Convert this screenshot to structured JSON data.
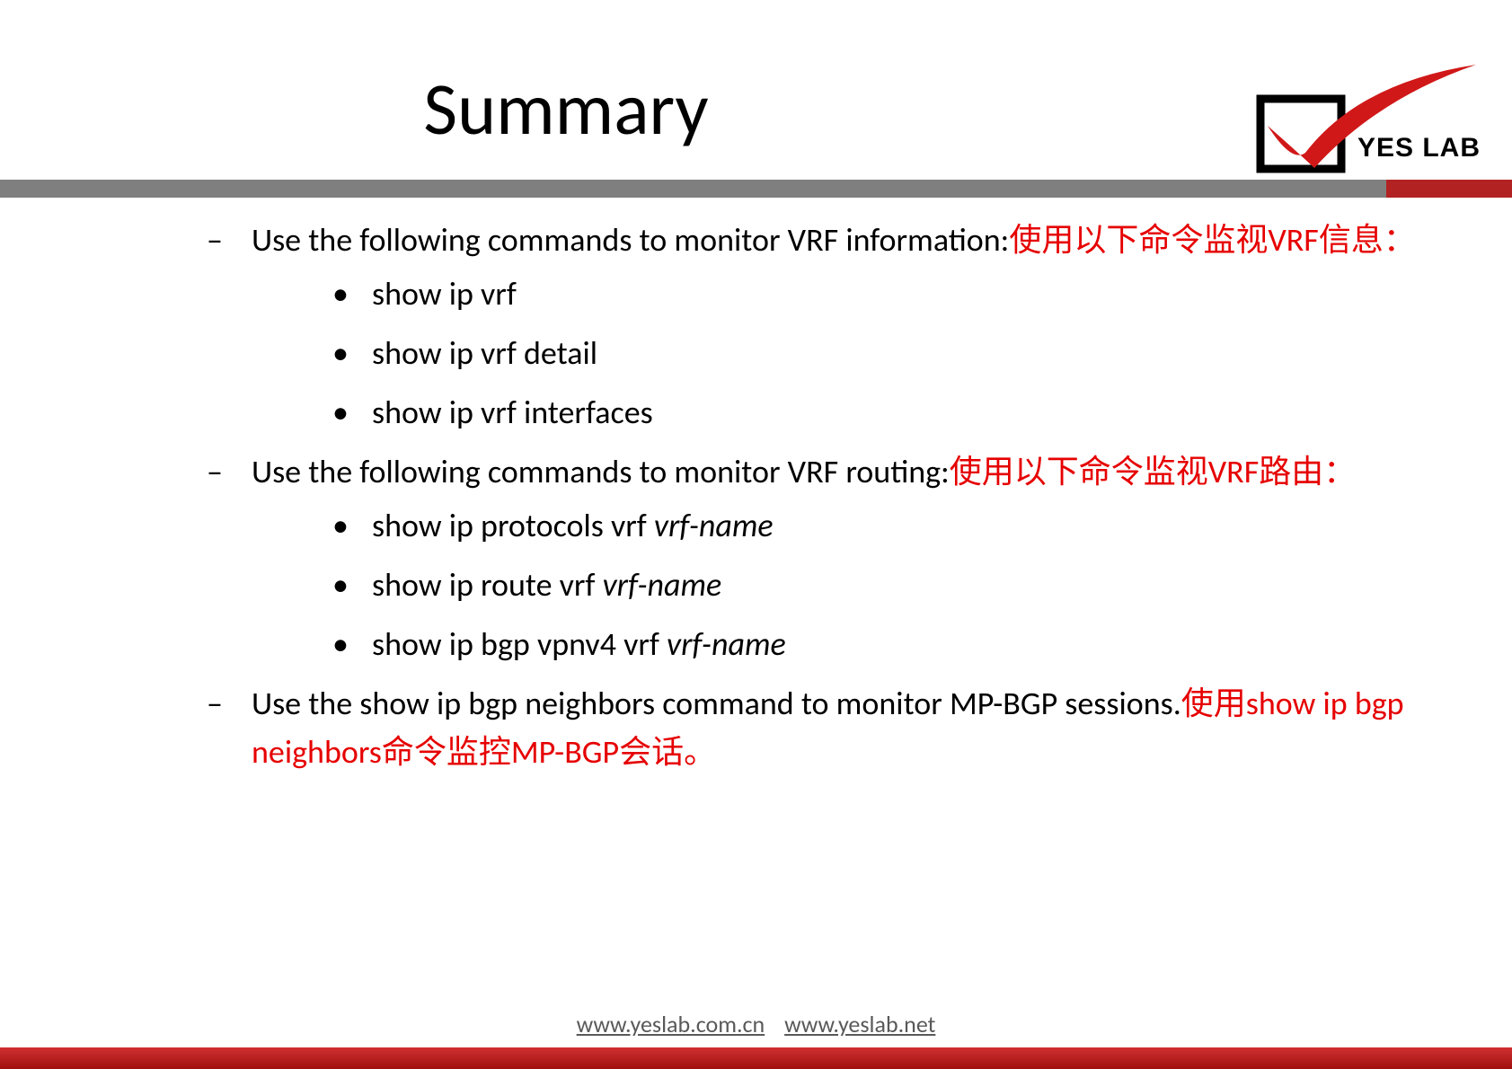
{
  "title": "Summary",
  "logo_text": "YES LAB",
  "bullets": [
    {
      "en": "Use the following commands to monitor VRF information:",
      "zh": "使用以下命令监视VRF信息：",
      "subs": [
        {
          "cmd": "show ip vrf",
          "arg": ""
        },
        {
          "cmd": "show ip vrf detail",
          "arg": ""
        },
        {
          "cmd": "show ip vrf interfaces",
          "arg": ""
        }
      ]
    },
    {
      "en": "Use the following commands to monitor VRF routing:",
      "zh": "使用以下命令监视VRF路由：",
      "subs": [
        {
          "cmd": "show ip protocols vrf ",
          "arg": "vrf-name"
        },
        {
          "cmd": "show ip route vrf ",
          "arg": "vrf-name"
        },
        {
          "cmd": "show ip bgp vpnv4 vrf ",
          "arg": "vrf-name"
        }
      ]
    },
    {
      "en": "Use the show ip bgp neighbors command to monitor MP-BGP sessions.",
      "zh": "使用show ip bgp neighbors命令监控MP-BGP会话。",
      "subs": []
    }
  ],
  "footer": {
    "link1": "www.yeslab.com.cn",
    "link2": "www.yeslab.net"
  }
}
